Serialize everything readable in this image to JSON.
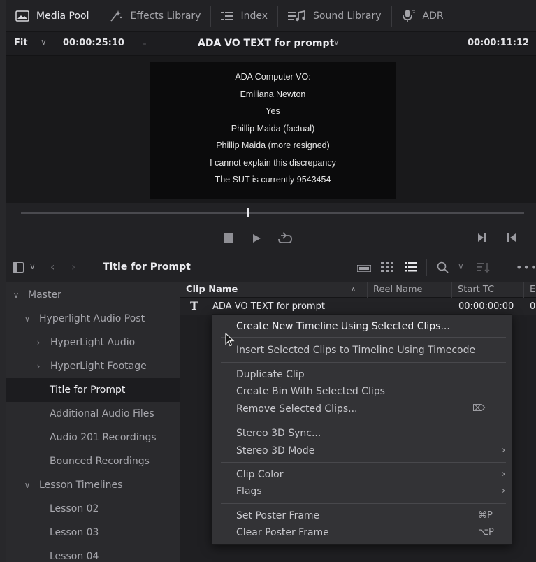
{
  "toolbar": {
    "items": [
      {
        "label": "Media Pool",
        "icon": "media-pool-icon"
      },
      {
        "label": "Effects Library",
        "icon": "effects-library-icon"
      },
      {
        "label": "Index",
        "icon": "index-icon"
      },
      {
        "label": "Sound Library",
        "icon": "sound-library-icon"
      },
      {
        "label": "ADR",
        "icon": "adr-mic-icon"
      }
    ]
  },
  "viewer": {
    "zoom": "Fit",
    "source_timecode": "00:00:25:10",
    "clip_title": "ADA VO TEXT for prompt",
    "record_timecode": "00:00:11:12",
    "frame_lines": [
      "ADA Computer VO:",
      "Emiliana Newton",
      "Yes",
      "Phillip Maida (factual)",
      "Phillip Maida (more resigned)",
      "I cannot explain this discrepancy",
      "The SUT is currently 9543454"
    ],
    "playhead_fraction": 0.45
  },
  "bin": {
    "title": "Title for Prompt"
  },
  "sidebar": {
    "items": [
      {
        "label": "Master",
        "chevron": "∨"
      },
      {
        "label": "Hyperlight Audio Post",
        "chevron": "∨"
      },
      {
        "label": "HyperLight Audio",
        "chevron": "›"
      },
      {
        "label": "HyperLight Footage",
        "chevron": "›"
      },
      {
        "label": "Title for Prompt",
        "chevron": ""
      },
      {
        "label": "Additional Audio Files",
        "chevron": ""
      },
      {
        "label": "Audio 201 Recordings",
        "chevron": ""
      },
      {
        "label": "Bounced Recordings",
        "chevron": ""
      },
      {
        "label": "Lesson Timelines",
        "chevron": "∨"
      },
      {
        "label": "Lesson 02",
        "chevron": ""
      },
      {
        "label": "Lesson 03",
        "chevron": ""
      },
      {
        "label": "Lesson 04",
        "chevron": ""
      }
    ],
    "selected": "Title for Prompt"
  },
  "clip_list": {
    "columns": {
      "name": "Clip Name",
      "reel": "Reel Name",
      "start": "Start TC",
      "end": "E"
    },
    "rows": [
      {
        "icon": "T",
        "name": "ADA VO TEXT for prompt",
        "start_tc": "00:00:00:00",
        "end_tc": "0"
      }
    ]
  },
  "context_menu": {
    "items": [
      {
        "label": "Create New Timeline Using Selected Clips...",
        "shortcut": ""
      },
      {
        "label": "Insert Selected Clips to Timeline Using Timecode",
        "shortcut": ""
      },
      {
        "label": "Duplicate Clip",
        "shortcut": ""
      },
      {
        "label": "Create Bin With Selected Clips",
        "shortcut": ""
      },
      {
        "label": "Remove Selected Clips...",
        "shortcut": "⌦"
      },
      {
        "label": "Stereo 3D Sync...",
        "shortcut": ""
      },
      {
        "label": "Stereo 3D Mode",
        "shortcut": "›"
      },
      {
        "label": "Clip Color",
        "shortcut": "›"
      },
      {
        "label": "Flags",
        "shortcut": "›"
      },
      {
        "label": "Set Poster Frame",
        "shortcut": "⌘P"
      },
      {
        "label": "Clear Poster Frame",
        "shortcut": "⌥P"
      }
    ]
  }
}
